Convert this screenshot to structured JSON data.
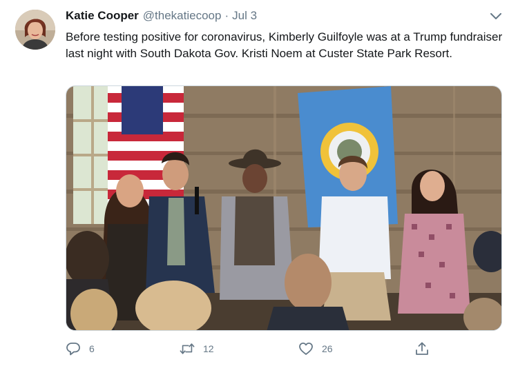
{
  "tweet": {
    "author_name": "Katie Cooper",
    "author_handle": "@thekatiecoop",
    "separator": "·",
    "date": "Jul 3",
    "text": "Before testing positive for coronavirus, Kimberly Guilfoyle was at a Trump fundraiser last night with South Dakota Gov. Kristi Noem at Custer State Park Resort."
  },
  "actions": {
    "reply_count": "6",
    "retweet_count": "12",
    "like_count": "26"
  },
  "icons": {
    "more": "chevron-down-icon",
    "reply": "reply-icon",
    "retweet": "retweet-icon",
    "like": "heart-icon",
    "share": "share-icon"
  },
  "colors": {
    "secondary_text": "#657786",
    "primary_text": "#14171a",
    "border": "#ccd6dd"
  }
}
